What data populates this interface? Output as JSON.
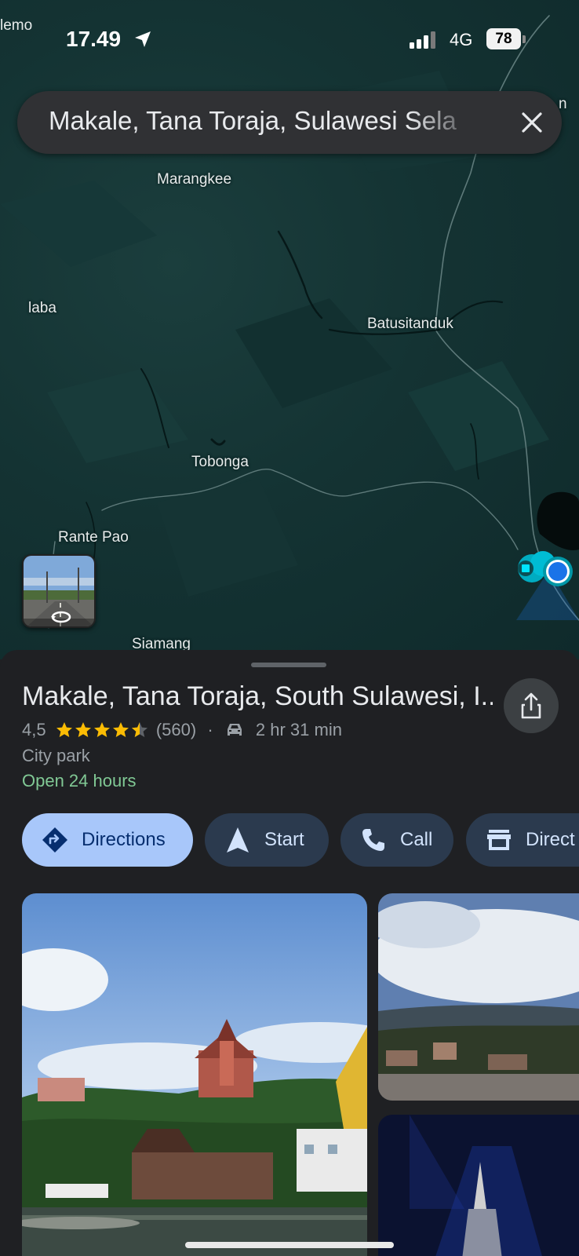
{
  "status_bar": {
    "carrier_edge": "lemo",
    "time": "17.49",
    "network": "4G",
    "battery": "78"
  },
  "search": {
    "query": "Makale, Tana Toraja, Sulawesi Sela",
    "close_icon": "close-icon"
  },
  "map": {
    "places": [
      {
        "name": "Marangkee"
      },
      {
        "name": "laba"
      },
      {
        "name": "Batusitanduk"
      },
      {
        "name": "Tobonga"
      },
      {
        "name": "Rante Pao"
      },
      {
        "name": "Siamang"
      }
    ],
    "edge_label": "n"
  },
  "place": {
    "title": "Makale, Tana Toraja, South Sulawesi, I...",
    "rating": "4,5",
    "rating_value": 4.5,
    "reviews": "(560)",
    "separator": "·",
    "drive_time": "2 hr 31 min",
    "category": "City park",
    "hours": "Open 24 hours"
  },
  "actions": [
    {
      "label": "Directions",
      "icon": "directions-icon"
    },
    {
      "label": "Start",
      "icon": "navigation-arrow-icon"
    },
    {
      "label": "Call",
      "icon": "phone-icon"
    },
    {
      "label": "Direct",
      "icon": "storefront-icon"
    }
  ],
  "colors": {
    "accent_chip": "#a8c7fa",
    "chip": "#2b3a4e",
    "open_green": "#81c995",
    "star": "#fbbc04",
    "location_blue": "#1a73e8"
  }
}
